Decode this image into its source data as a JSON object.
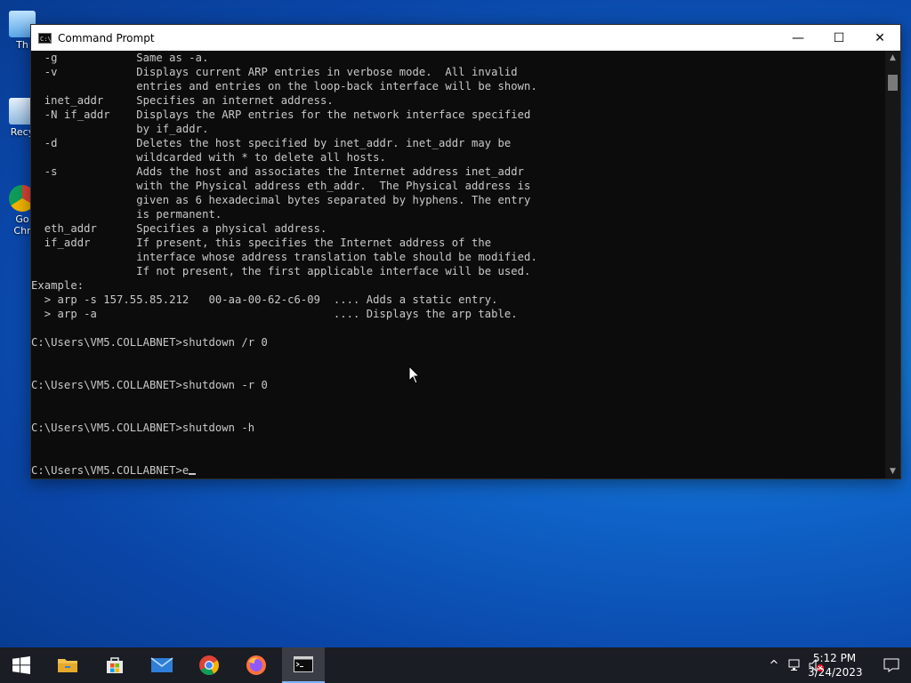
{
  "desktop": {
    "icons": [
      {
        "name": "this-pc",
        "label": "Th"
      },
      {
        "name": "recycle-bin",
        "label": "Recy"
      },
      {
        "name": "google-chrome",
        "label": "Go",
        "label2": "Chr"
      }
    ]
  },
  "window": {
    "title": "Command Prompt",
    "app_icon_text": "C:\\_",
    "controls": {
      "minimize": "—",
      "maximize": "☐",
      "close": "✕"
    }
  },
  "console": {
    "lines": [
      "  -g            Same as -a.",
      "  -v            Displays current ARP entries in verbose mode.  All invalid",
      "                entries and entries on the loop-back interface will be shown.",
      "  inet_addr     Specifies an internet address.",
      "  -N if_addr    Displays the ARP entries for the network interface specified",
      "                by if_addr.",
      "  -d            Deletes the host specified by inet_addr. inet_addr may be",
      "                wildcarded with * to delete all hosts.",
      "  -s            Adds the host and associates the Internet address inet_addr",
      "                with the Physical address eth_addr.  The Physical address is",
      "                given as 6 hexadecimal bytes separated by hyphens. The entry",
      "                is permanent.",
      "  eth_addr      Specifies a physical address.",
      "  if_addr       If present, this specifies the Internet address of the",
      "                interface whose address translation table should be modified.",
      "                If not present, the first applicable interface will be used.",
      "Example:",
      "  > arp -s 157.55.85.212   00-aa-00-62-c6-09  .... Adds a static entry.",
      "  > arp -a                                    .... Displays the arp table.",
      "",
      "C:\\Users\\VM5.COLLABNET>shutdown /r 0",
      "",
      "",
      "C:\\Users\\VM5.COLLABNET>shutdown -r 0",
      "",
      "",
      "C:\\Users\\VM5.COLLABNET>shutdown -h",
      "",
      ""
    ],
    "prompt": "C:\\Users\\VM5.COLLABNET>",
    "current_input": "e"
  },
  "scrollbar": {
    "up": "▲",
    "down": "▼"
  },
  "taskbar": {
    "items": [
      {
        "name": "start",
        "icon": "windows-logo-icon"
      },
      {
        "name": "file-explorer",
        "icon": "folder-icon"
      },
      {
        "name": "microsoft-store",
        "icon": "store-icon"
      },
      {
        "name": "mail",
        "icon": "mail-icon"
      },
      {
        "name": "google-chrome",
        "icon": "chrome-icon"
      },
      {
        "name": "firefox",
        "icon": "firefox-icon"
      },
      {
        "name": "command-prompt",
        "icon": "cmd-icon",
        "active": true
      }
    ],
    "tray": {
      "chevron": "^",
      "time": "5:12 PM",
      "date": "3/24/2023"
    }
  },
  "colors": {
    "console_bg": "#0c0c0c",
    "console_text": "#c9c9c9",
    "taskbar_bg": "#1a1d24",
    "accent": "#7fb2ff"
  }
}
